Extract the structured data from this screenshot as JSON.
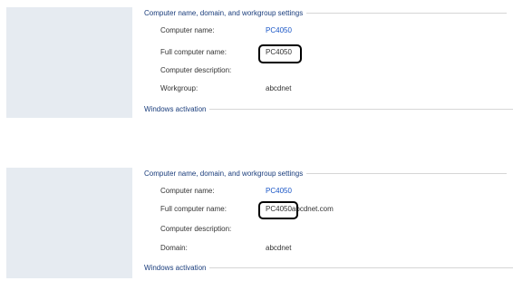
{
  "panels": [
    {
      "section_title": "Computer name, domain, and workgroup settings",
      "rows": [
        {
          "label": "Computer name:",
          "value": "PC4050",
          "link": true
        },
        {
          "label": "Full computer name:",
          "value": "PC4050",
          "link": false
        },
        {
          "label": "Computer description:",
          "value": ""
        },
        {
          "label": "Workgroup:",
          "value": "abcdnet",
          "link": false
        }
      ],
      "footer_section": "Windows activation"
    },
    {
      "section_title": "Computer name, domain, and workgroup settings",
      "rows": [
        {
          "label": "Computer name:",
          "value": "PC4050",
          "link": true
        },
        {
          "label": "Full computer name:",
          "value": "PC4050",
          "value_suffix": "abcdnet.com",
          "link": false
        },
        {
          "label": "Computer description:",
          "value": ""
        },
        {
          "label": "Domain:",
          "value": "abcdnet",
          "link": false
        }
      ],
      "footer_section": "Windows activation"
    }
  ],
  "colors": {
    "sidebar": "#e6ebf1",
    "section_title": "#1a3d7c",
    "link": "#1a56c6",
    "highlight": "#000000"
  }
}
